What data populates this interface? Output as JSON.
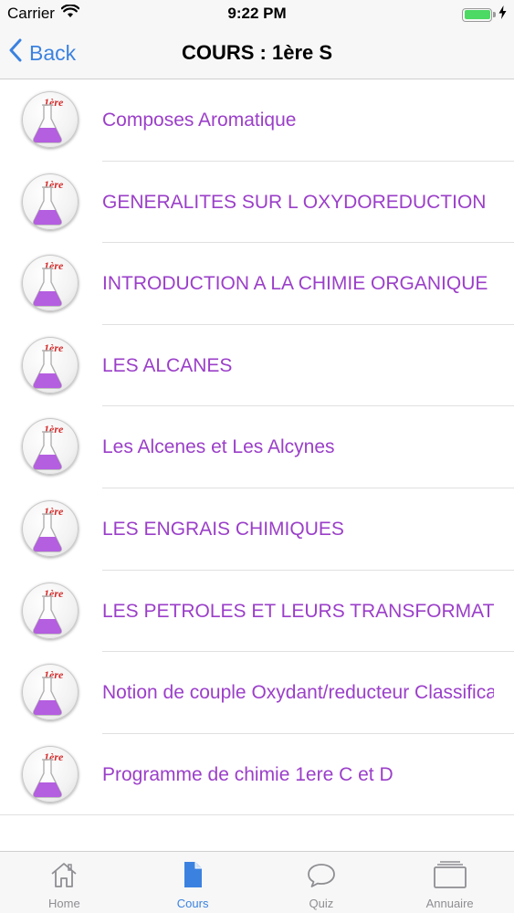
{
  "status_bar": {
    "carrier": "Carrier",
    "time": "9:22 PM",
    "battery_level": 1.0,
    "battery_color": "#4cd964"
  },
  "nav": {
    "back_label": "Back",
    "title": "COURS : 1ère S"
  },
  "thumbnail": {
    "badge_text": "1ère",
    "icon": "flask-icon",
    "liquid_color": "#b45ee0"
  },
  "courses": [
    {
      "title": "Composes Aromatique"
    },
    {
      "title": "GENERALITES SUR L OXYDOREDUCTION"
    },
    {
      "title": "INTRODUCTION A LA CHIMIE ORGANIQUE"
    },
    {
      "title": "LES ALCANES"
    },
    {
      "title": "Les Alcenes et Les Alcynes"
    },
    {
      "title": "LES ENGRAIS CHIMIQUES"
    },
    {
      "title": "LES PETROLES ET LEURS TRANSFORMATIONS"
    },
    {
      "title": "Notion de couple Oxydant/reducteur Classification"
    },
    {
      "title": "Programme de chimie 1ere C et D"
    }
  ],
  "tabs": [
    {
      "label": "Home",
      "icon": "home-icon",
      "active": false
    },
    {
      "label": "Cours",
      "icon": "document-icon",
      "active": true
    },
    {
      "label": "Quiz",
      "icon": "chat-bubble-icon",
      "active": false
    },
    {
      "label": "Annuaire",
      "icon": "folder-icon",
      "active": false
    }
  ],
  "colors": {
    "accent": "#3b82e0",
    "course_text": "#9b3fc9",
    "inactive_tab": "#8e8e93"
  }
}
